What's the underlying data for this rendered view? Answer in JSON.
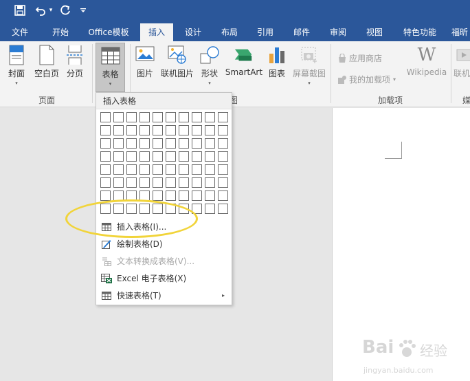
{
  "quick_access": {
    "save_glyph": "🖫",
    "undo_glyph": "↶",
    "undo_caret": "▾",
    "redo_glyph": "↺",
    "customize_glyph": "₌"
  },
  "tabs": [
    {
      "label": "文件"
    },
    {
      "label": "开始"
    },
    {
      "label": "Office模板"
    },
    {
      "label": "插入"
    },
    {
      "label": "设计"
    },
    {
      "label": "布局"
    },
    {
      "label": "引用"
    },
    {
      "label": "邮件"
    },
    {
      "label": "审阅"
    },
    {
      "label": "视图"
    },
    {
      "label": "特色功能"
    },
    {
      "label": "福昕"
    }
  ],
  "ribbon": {
    "pages_group": {
      "label": "页面",
      "cover": "封面",
      "blank_page": "空白页",
      "page_break": "分页"
    },
    "table_group": {
      "table": "表格"
    },
    "illustrations_group": {
      "label": "图",
      "picture": "图片",
      "online_picture": "联机图片",
      "shapes": "形状",
      "smartart": "SmartArt",
      "chart": "图表",
      "screenshot": "屏幕截图"
    },
    "addins_group": {
      "label": "加载项",
      "store": "应用商店",
      "my_addins": "我的加载项",
      "wikipedia": "Wikipedia",
      "wiki_glyph": "W"
    },
    "media_group": {
      "online_video": "联机",
      "label": "媒"
    },
    "caret": "▾"
  },
  "dropdown": {
    "header": "插入表格",
    "grid": {
      "columns": 10,
      "rows": 8
    },
    "items": [
      {
        "label": "插入表格(I)...",
        "enabled": true
      },
      {
        "label": "绘制表格(D)",
        "enabled": true
      },
      {
        "label": "文本转换成表格(V)...",
        "enabled": false
      },
      {
        "label": "Excel 电子表格(X)",
        "enabled": true
      },
      {
        "label": "快速表格(T)",
        "enabled": true,
        "submenu_glyph": "▸"
      }
    ]
  },
  "watermark": {
    "brand": "Bai",
    "brand_cn": "经验",
    "url": "jingyan.baidu.com"
  },
  "colors": {
    "title_bar": "#2b579a",
    "ribbon_bg": "#f3f3f3",
    "doc_bg": "#e6e6e6",
    "highlight": "#f1d43a"
  }
}
